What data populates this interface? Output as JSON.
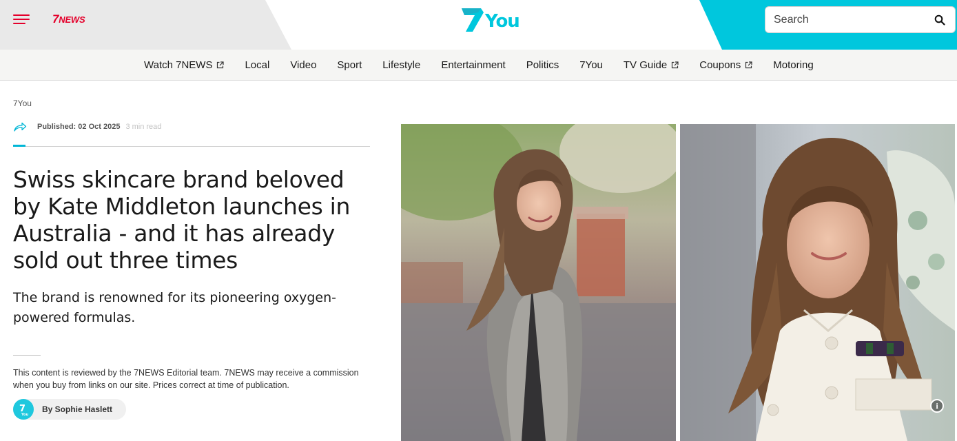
{
  "header": {
    "brand": "7NEWS",
    "brand_seven": "7",
    "brand_news": "NEWS",
    "section_logo": "7You",
    "section_logo_seven": "7",
    "section_logo_you": "You",
    "search": {
      "placeholder": "Search"
    },
    "colors": {
      "red": "#e4002b",
      "teal": "#00c7dd",
      "nav_bg": "#f5f5f3"
    }
  },
  "nav": {
    "items": [
      {
        "label": "Watch 7NEWS",
        "external": true
      },
      {
        "label": "Local",
        "external": false
      },
      {
        "label": "Video",
        "external": false
      },
      {
        "label": "Sport",
        "external": false
      },
      {
        "label": "Lifestyle",
        "external": false
      },
      {
        "label": "Entertainment",
        "external": false
      },
      {
        "label": "Politics",
        "external": false
      },
      {
        "label": "7You",
        "external": false
      },
      {
        "label": "TV Guide",
        "external": true
      },
      {
        "label": "Coupons",
        "external": true
      },
      {
        "label": "Motoring",
        "external": false
      }
    ]
  },
  "article": {
    "section": "7You",
    "published": "Published: 02 Oct 2025",
    "read_time": "3 min read",
    "headline": "Swiss skincare brand beloved by Kate Middleton launches in Australia - and it has already sold out three times",
    "standfirst": "The brand is renowned for its pioneering oxygen-powered formulas.",
    "disclaimer": "This content is reviewed by the 7NEWS Editorial team. 7NEWS may receive a commission when you buy from links on our site. Prices correct at time of publication.",
    "author": "By Sophie Haslett",
    "author_avatar_text": "7",
    "author_avatar_sub": "You"
  },
  "images": {
    "info_label": "i"
  }
}
